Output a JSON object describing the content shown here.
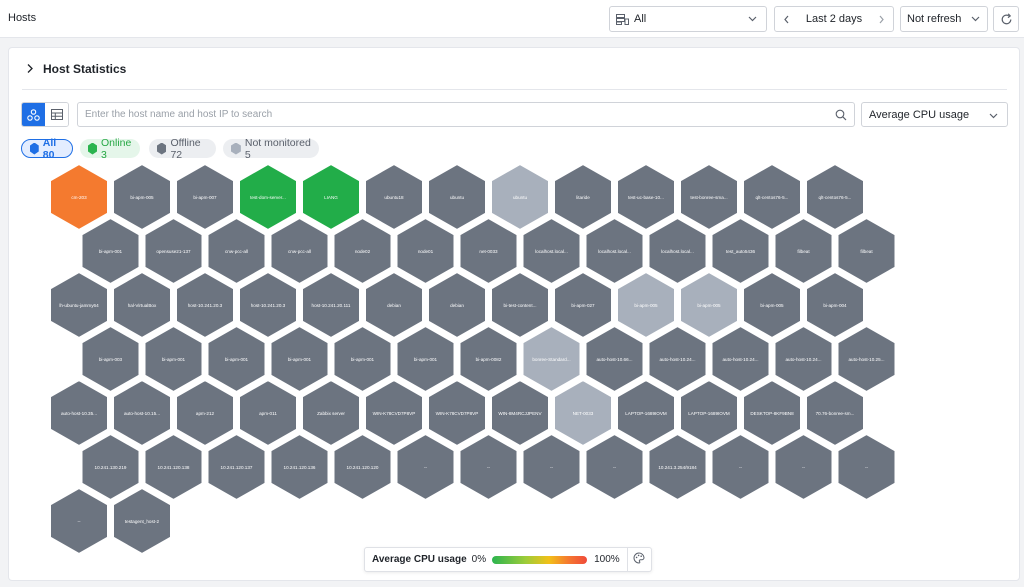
{
  "header": {
    "title": "Hosts",
    "host_filter": "All",
    "time_range": "Last 2 days",
    "refresh": "Not refresh"
  },
  "section": {
    "title": "Host Statistics"
  },
  "toolbar": {
    "search_placeholder": "Enter the host name and host IP to search",
    "metric": "Average CPU usage"
  },
  "filters": {
    "all": "All 80",
    "online": "Online 3",
    "offline": "Offline 72",
    "not_monitored": "Not monitored 5"
  },
  "colors": {
    "high": "#f47a2f",
    "online": "#22ad49",
    "offline": "#6c7480",
    "not_monitored": "#a8b0bc",
    "accent": "#1f6fe5"
  },
  "hosts": [
    [
      {
        "name": "cm-203",
        "status": "high"
      },
      {
        "name": "bi-apm-005",
        "status": "offline"
      },
      {
        "name": "bi-apm-007",
        "status": "offline"
      },
      {
        "name": "test-dom-server...",
        "status": "online"
      },
      {
        "name": "LIANG",
        "status": "online"
      },
      {
        "name": "ubuntu18",
        "status": "offline"
      },
      {
        "name": "ubuntu",
        "status": "offline"
      },
      {
        "name": "ubuntu",
        "status": "not_monitored"
      },
      {
        "name": "litaride",
        "status": "offline"
      },
      {
        "name": "test-uc-base-10...",
        "status": "offline"
      },
      {
        "name": "test-bonree-sma...",
        "status": "offline"
      },
      {
        "name": "qlt-centos76-5...",
        "status": "offline"
      },
      {
        "name": "qlt-centos76-5...",
        "status": "offline"
      }
    ],
    [
      {
        "name": "bi-apm-001",
        "status": "offline"
      },
      {
        "name": "opensuse21-137",
        "status": "offline"
      },
      {
        "name": "cnw-pcc-all",
        "status": "offline"
      },
      {
        "name": "cnw-pcc-all",
        "status": "offline"
      },
      {
        "name": "node02",
        "status": "offline"
      },
      {
        "name": "node01",
        "status": "offline"
      },
      {
        "name": "net-0033",
        "status": "offline"
      },
      {
        "name": "localhost.local...",
        "status": "offline"
      },
      {
        "name": "localhost.local...",
        "status": "offline"
      },
      {
        "name": "localhost.local...",
        "status": "offline"
      },
      {
        "name": "test_auto5436",
        "status": "offline"
      },
      {
        "name": "filbeat",
        "status": "offline"
      },
      {
        "name": "filbeat",
        "status": "offline"
      }
    ],
    [
      {
        "name": "lh-ubuntu-jammy64",
        "status": "offline"
      },
      {
        "name": "hal-VirtualBox",
        "status": "offline"
      },
      {
        "name": "host-10.241.20.3",
        "status": "offline"
      },
      {
        "name": "host-10.241.20.3",
        "status": "offline"
      },
      {
        "name": "host-10.241.20.111",
        "status": "offline"
      },
      {
        "name": "debian",
        "status": "offline"
      },
      {
        "name": "debian",
        "status": "offline"
      },
      {
        "name": "bi-test-content...",
        "status": "offline"
      },
      {
        "name": "bi-apm-027",
        "status": "offline"
      },
      {
        "name": "bi-apm-005",
        "status": "not_monitored"
      },
      {
        "name": "bi-apm-005",
        "status": "not_monitored"
      },
      {
        "name": "bi-apm-005",
        "status": "offline"
      },
      {
        "name": "bi-apm-004",
        "status": "offline"
      }
    ],
    [
      {
        "name": "bi-apm-003",
        "status": "offline"
      },
      {
        "name": "bi-apm-001",
        "status": "offline"
      },
      {
        "name": "bi-apm-001",
        "status": "offline"
      },
      {
        "name": "bi-apm-001",
        "status": "offline"
      },
      {
        "name": "bi-apm-001",
        "status": "offline"
      },
      {
        "name": "bi-apm-001",
        "status": "offline"
      },
      {
        "name": "bi-apm-0082",
        "status": "offline"
      },
      {
        "name": "bonree-Standard...",
        "status": "not_monitored"
      },
      {
        "name": "auto-host-10.66...",
        "status": "offline"
      },
      {
        "name": "auto-host-10.24...",
        "status": "offline"
      },
      {
        "name": "auto-host-10.24...",
        "status": "offline"
      },
      {
        "name": "auto-host-10.24...",
        "status": "offline"
      },
      {
        "name": "auto-host-10.25...",
        "status": "offline"
      }
    ],
    [
      {
        "name": "auto-host-10.35...",
        "status": "offline"
      },
      {
        "name": "auto-host-10.15...",
        "status": "offline"
      },
      {
        "name": "apm-212",
        "status": "offline"
      },
      {
        "name": "apm-011",
        "status": "offline"
      },
      {
        "name": "Zabbix server",
        "status": "offline"
      },
      {
        "name": "WIN-K78CVD7P8VP",
        "status": "offline"
      },
      {
        "name": "WIN-K78CVD7P8VP",
        "status": "offline"
      },
      {
        "name": "WIN-8M4RCJJPENV",
        "status": "offline"
      },
      {
        "name": "NET-0033",
        "status": "not_monitored"
      },
      {
        "name": "LAPTOP-1689IOVM",
        "status": "offline"
      },
      {
        "name": "LAPTOP-1689IOVM",
        "status": "offline"
      },
      {
        "name": "DESKTOP-8KF9BN8",
        "status": "offline"
      },
      {
        "name": "70.76-bonree-sm...",
        "status": "offline"
      }
    ],
    [
      {
        "name": "10.241.130.219",
        "status": "offline"
      },
      {
        "name": "10.241.120.138",
        "status": "offline"
      },
      {
        "name": "10.241.120.137",
        "status": "offline"
      },
      {
        "name": "10.241.120.136",
        "status": "offline"
      },
      {
        "name": "10.241.120.120",
        "status": "offline"
      },
      {
        "name": "--",
        "status": "offline"
      },
      {
        "name": "--",
        "status": "offline"
      },
      {
        "name": "--",
        "status": "offline"
      },
      {
        "name": "--",
        "status": "offline"
      },
      {
        "name": "10.241.3.254/9184",
        "status": "offline"
      },
      {
        "name": "--",
        "status": "offline"
      },
      {
        "name": "--",
        "status": "offline"
      },
      {
        "name": "--",
        "status": "offline"
      }
    ],
    [
      {
        "name": "--",
        "status": "offline"
      },
      {
        "name": "testagent_host-2",
        "status": "offline"
      }
    ]
  ],
  "legend": {
    "title": "Average CPU usage",
    "min": "0%",
    "max": "100%"
  }
}
